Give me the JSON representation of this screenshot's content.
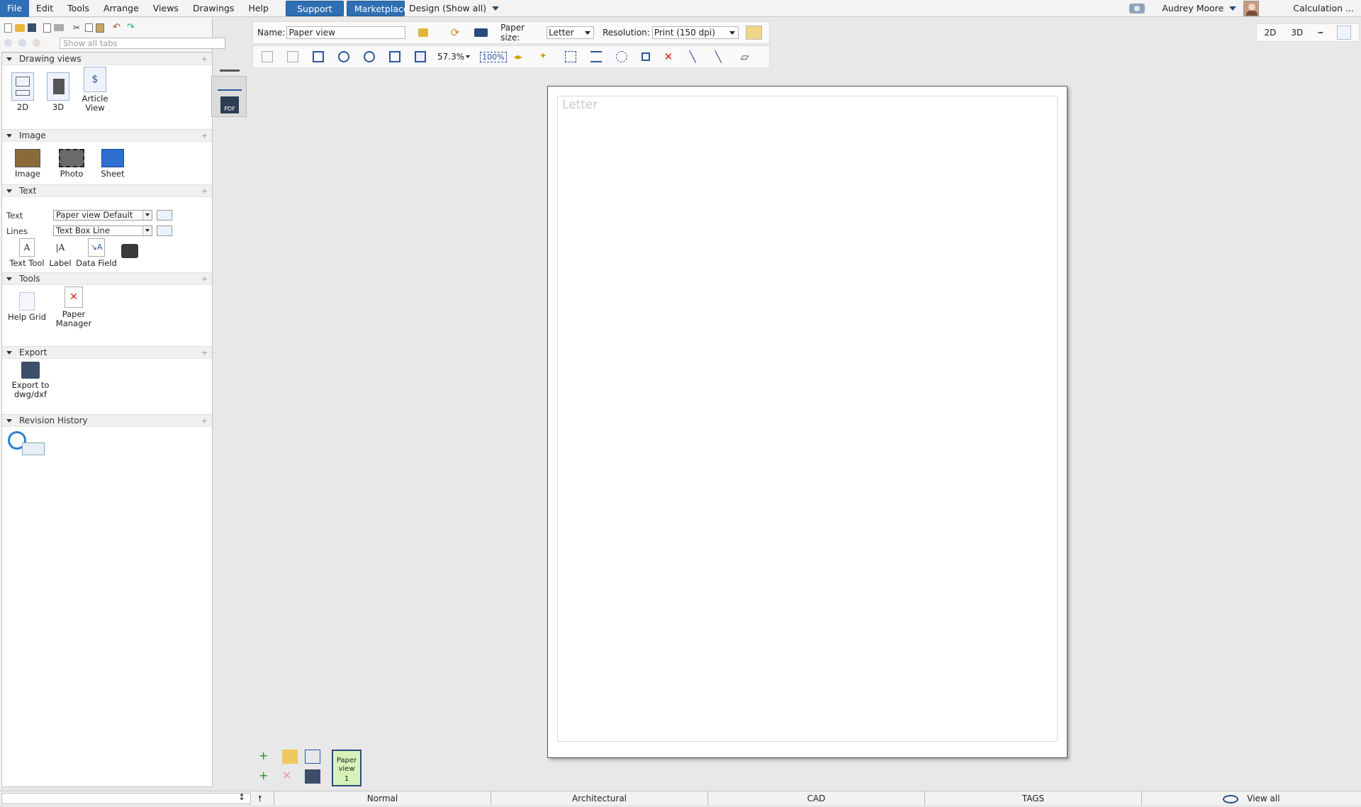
{
  "menubar": {
    "items": [
      "File",
      "Edit",
      "Tools",
      "Arrange",
      "Views",
      "Drawings",
      "Help"
    ],
    "support_label": "Support",
    "marketplace_label": "Marketplace",
    "design_label": "Design (Show all)",
    "user_name": "Audrey Moore",
    "calculation_label": "Calculation ..."
  },
  "left_toolbar": {
    "search_placeholder": "Show all tabs"
  },
  "sections": {
    "drawing_views": {
      "title": "Drawing views",
      "tools": [
        "2D",
        "3D",
        "Article View"
      ]
    },
    "image": {
      "title": "Image",
      "tools": [
        "Image",
        "Photo",
        "Sheet"
      ]
    },
    "text": {
      "title": "Text",
      "text_label": "Text",
      "text_value": "Paper view Default",
      "lines_label": "Lines",
      "lines_value": "Text Box Line",
      "tools": [
        "Text Tool",
        "Label",
        "Data Field"
      ]
    },
    "tools": {
      "title": "Tools",
      "tools": [
        "Help Grid",
        "Paper Manager"
      ]
    },
    "export": {
      "title": "Export",
      "tools": [
        "Export to dwg/dxf"
      ]
    },
    "revision": {
      "title": "Revision History"
    }
  },
  "toolbar1": {
    "name_label": "Name:",
    "name_value": "Paper view",
    "paper_size_label": "Paper size:",
    "paper_size_value": "Letter",
    "resolution_label": "Resolution:",
    "resolution_value": "Print (150 dpi)"
  },
  "toolbar2": {
    "zoom_value": "57.3%",
    "zoom_100": "100%"
  },
  "viewswitch": {
    "btn_2d": "2D",
    "btn_3d": "3D"
  },
  "canvas": {
    "page_label": "Letter"
  },
  "pagetab": {
    "label_line1": "Paper",
    "label_line2": "view",
    "number": "1"
  },
  "statusbar": {
    "segments": [
      "Normal",
      "Architectural",
      "CAD",
      "TAGS"
    ],
    "view_all": "View all"
  },
  "colors": {
    "accent": "#2f6fb3",
    "page_tab_bg": "#d6f2b8"
  }
}
